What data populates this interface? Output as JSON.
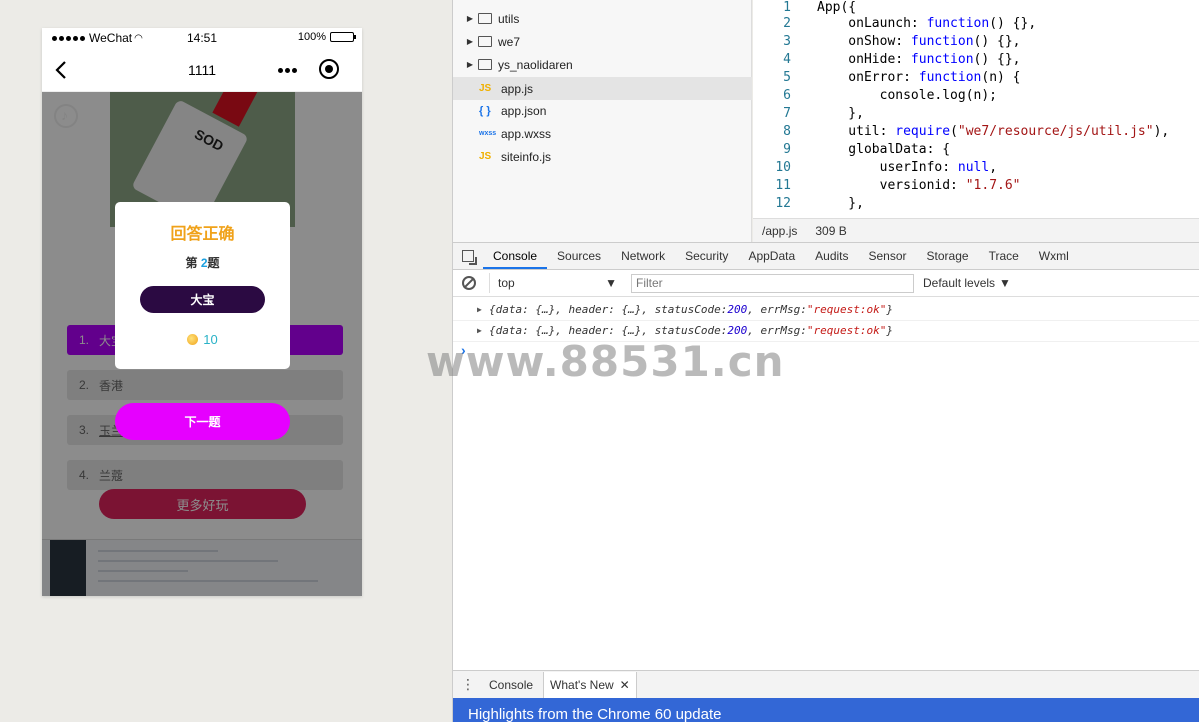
{
  "phone": {
    "status": {
      "carrier": "WeChat",
      "time": "14:51",
      "battery": "100%",
      "battery_level": 1.0
    },
    "nav": {
      "title": "1111"
    },
    "question_image": {
      "label": "SOD"
    },
    "options": [
      {
        "num": "1.",
        "text": "大宝"
      },
      {
        "num": "2.",
        "text": "香港"
      },
      {
        "num": "3.",
        "text": "玉兰油"
      },
      {
        "num": "4.",
        "text": "兰蔻"
      }
    ],
    "more_fun_label": "更多好玩",
    "modal": {
      "title": "回答正确",
      "qno_prefix": "第",
      "qno": "2",
      "qno_suffix": "题",
      "answer": "大宝",
      "coins": "10"
    },
    "next_label": "下一题"
  },
  "file_tree": [
    {
      "type": "folder",
      "name": "utils"
    },
    {
      "type": "folder",
      "name": "we7"
    },
    {
      "type": "folder",
      "name": "ys_naolidaren"
    },
    {
      "type": "js",
      "name": "app.js",
      "icon": "JS",
      "active": true
    },
    {
      "type": "json",
      "name": "app.json",
      "icon": "{ }"
    },
    {
      "type": "wxss",
      "name": "app.wxss",
      "icon": "wxss"
    },
    {
      "type": "js",
      "name": "siteinfo.js",
      "icon": "JS"
    }
  ],
  "editor": {
    "lines": [
      "1",
      "2",
      "3",
      "4",
      "5",
      "6",
      "7",
      "8",
      "9",
      "10",
      "11",
      "12"
    ],
    "file_path": "/app.js",
    "file_size": "309 B"
  },
  "devtools_tabs": [
    "Console",
    "Sources",
    "Network",
    "Security",
    "AppData",
    "Audits",
    "Sensor",
    "Storage",
    "Trace",
    "Wxml"
  ],
  "console": {
    "context": "top",
    "filter_placeholder": "Filter",
    "levels": "Default levels",
    "logs": [
      {
        "text_a": "{data: {…}, header: {…}, statusCode: ",
        "status": "200",
        "text_b": ", errMsg: ",
        "msg": "\"request:ok\"",
        "text_c": "}"
      },
      {
        "text_a": "{data: {…}, header: {…}, statusCode: ",
        "status": "200",
        "text_b": ", errMsg: ",
        "msg": "\"request:ok\"",
        "text_c": "}"
      }
    ]
  },
  "watermark": "www.88531.cn",
  "drawer": {
    "tabs": [
      "Console",
      "What's New"
    ],
    "banner": "Highlights from the Chrome 60 update"
  }
}
